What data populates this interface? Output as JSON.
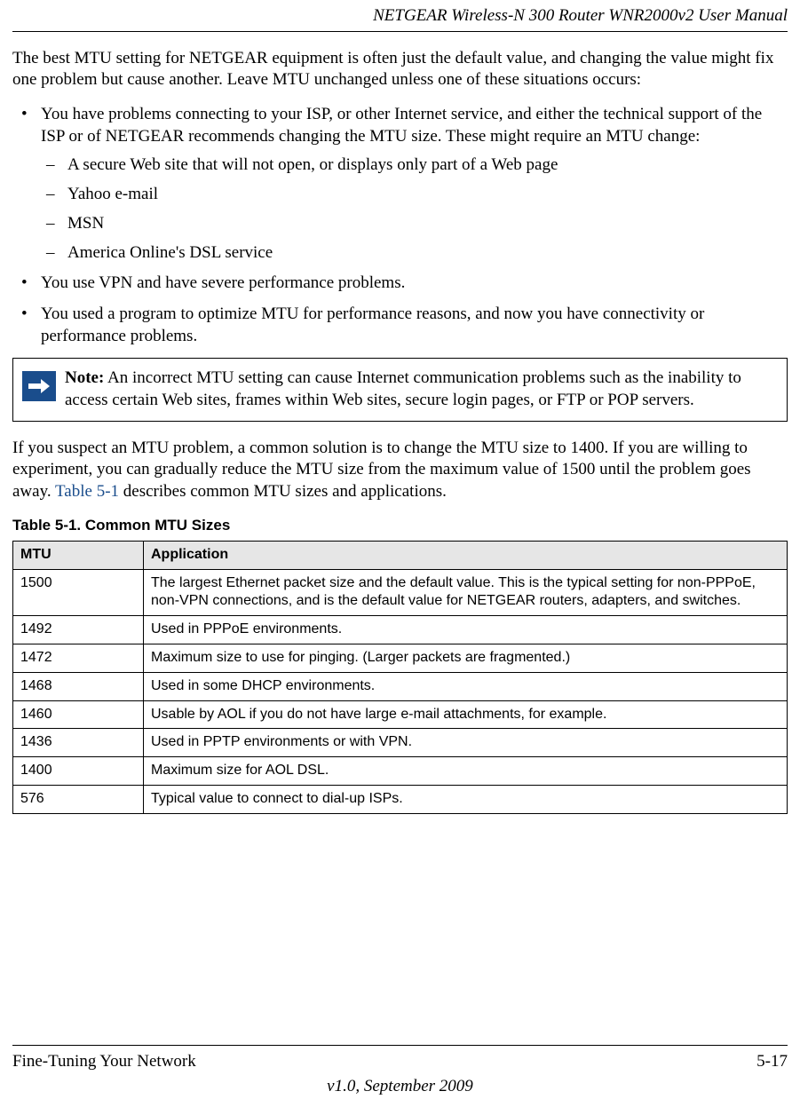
{
  "header": {
    "title": "NETGEAR Wireless-N 300 Router WNR2000v2 User Manual"
  },
  "intro": "The best MTU setting for NETGEAR equipment is often just the default value, and changing the value might fix one problem but cause another. Leave MTU unchanged unless one of these situations occurs:",
  "bullets": [
    {
      "text": "You have problems connecting to your ISP, or other Internet service, and either the technical support of the ISP or of NETGEAR recommends changing the MTU size. These might require an MTU change:",
      "sub": [
        "A secure Web site that will not open, or displays only part of a Web page",
        "Yahoo e-mail",
        "MSN",
        "America Online's DSL service"
      ]
    },
    {
      "text": "You use VPN and have severe performance problems."
    },
    {
      "text": "You used a program to optimize MTU for performance reasons, and now you have connectivity or performance problems."
    }
  ],
  "note": {
    "label": "Note:",
    "text": " An incorrect MTU setting can cause Internet communication problems such as the inability to access certain Web sites, frames within Web sites, secure login pages, or FTP or POP servers."
  },
  "suspect": {
    "before": "If you suspect an MTU problem, a common solution is to change the MTU size to 1400. If you are willing to experiment, you can gradually reduce the MTU size from the maximum value of 1500 until the problem goes away. ",
    "link": "Table 5-1",
    "after": " describes common MTU sizes and applications."
  },
  "table": {
    "caption": "Table 5-1.  Common MTU Sizes",
    "headers": {
      "mtu": "MTU",
      "app": "Application"
    },
    "rows": [
      {
        "mtu": "1500",
        "app": "The largest Ethernet packet size and the default value. This is the typical setting for non-PPPoE, non-VPN connections, and is the default value for NETGEAR routers, adapters, and switches."
      },
      {
        "mtu": "1492",
        "app": "Used in PPPoE environments."
      },
      {
        "mtu": "1472",
        "app": "Maximum size to use for pinging. (Larger packets are fragmented.)"
      },
      {
        "mtu": "1468",
        "app": "Used in some DHCP environments."
      },
      {
        "mtu": "1460",
        "app": "Usable by AOL if you do not have large e-mail attachments, for example."
      },
      {
        "mtu": "1436",
        "app": "Used in PPTP environments or with VPN."
      },
      {
        "mtu": "1400",
        "app": "Maximum size for AOL DSL."
      },
      {
        "mtu": "576",
        "app": "Typical value to connect to dial-up ISPs."
      }
    ]
  },
  "footer": {
    "section": "Fine-Tuning Your Network",
    "page": "5-17",
    "version": "v1.0, September 2009"
  }
}
